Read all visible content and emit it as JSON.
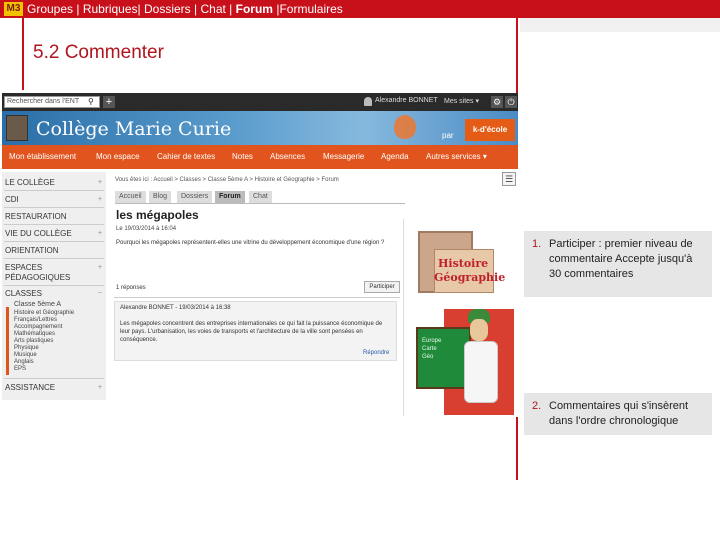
{
  "topbar": {
    "logo": "M3",
    "nav": [
      "Groupes |",
      "Rubriques|",
      "Dossiers |",
      "Chat |",
      "Forum",
      "|Formulaires"
    ]
  },
  "slide": {
    "title": "5.2 Commenter"
  },
  "ent": {
    "search_placeholder": "Rechercher dans l'ENT",
    "user": "Alexandre BONNET",
    "sites": "Mes sites ▾",
    "school": "Collège Marie Curie",
    "par": "par",
    "partner": "k-d'école",
    "menu": [
      "Mon établissement",
      "Mon espace",
      "Cahier de textes",
      "Notes",
      "Absences",
      "Messagerie",
      "Agenda",
      "Autres services ▾"
    ],
    "sidebar": [
      {
        "label": "LE COLLÈGE"
      },
      {
        "label": "CDI"
      },
      {
        "label": "RESTAURATION"
      },
      {
        "label": "VIE DU COLLÈGE"
      },
      {
        "label": "ORIENTATION"
      },
      {
        "label": "ESPACES PÉDAGOGIQUES"
      },
      {
        "label": "CLASSES"
      },
      {
        "label": "ASSISTANCE"
      }
    ],
    "class_sub": [
      "Classe 5ème A",
      "Histoire et Géographie",
      "Français/Lettres",
      "Accompagnement",
      "Mathématiques",
      "Arts plastiques",
      "Physique",
      "Musique",
      "Anglais",
      "EPS"
    ],
    "breadcrumb": "Vous êtes ici : Accueil > Classes > Classe 5ème A > Histoire et Géographie > Forum",
    "tabs": [
      "Accueil",
      "Blog",
      "Dossiers",
      "Forum",
      "Chat"
    ],
    "topic_title": "les mégapoles",
    "topic_date": "Le 19/03/2014 à 16:04",
    "topic_question": "Pourquoi les mégapoles représentent-elles une vitrine du développement économique d'une région ?",
    "replies": "1 réponses",
    "participate": "Participer",
    "reply_author": "Alexandre BONNET - 19/03/2014 à 16:38",
    "reply_text": "Les mégapoles concentrent des entreprises internationales ce qui fait la puissance économique de leur pays. L'urbanisation, les voies de transports et l'architecture de la ville sont pensées en conséquence.",
    "reply_link": "Répondre",
    "illus_title1": "Histoire",
    "illus_title2": "Géographie",
    "board_text": "Europe\nCarte\nGéo"
  },
  "notes": [
    {
      "num": "1.",
      "text": "Participer : premier niveau de commentaire Accepte jusqu'à 30 commentaires"
    },
    {
      "num": "2.",
      "text": "Commentaires qui s'insèrent dans l'ordre chronologique"
    }
  ],
  "colors": {
    "brand_red": "#c8101b",
    "menu_orange": "#e2541e"
  }
}
